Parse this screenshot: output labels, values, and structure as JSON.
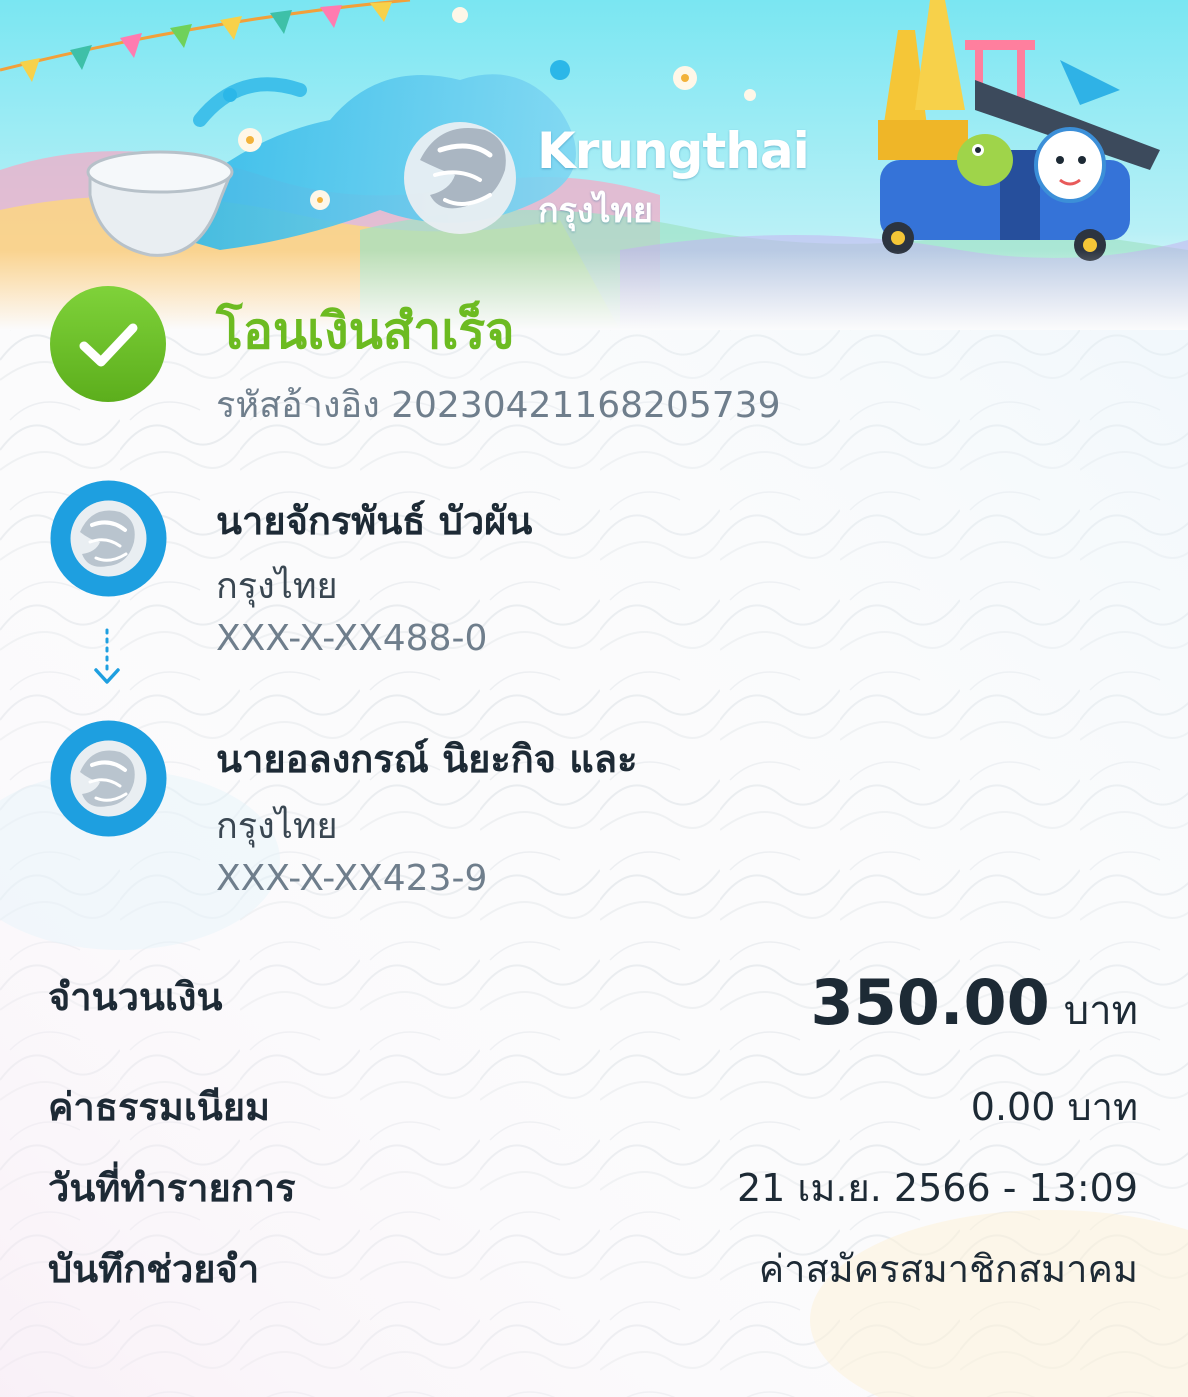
{
  "header": {
    "brand_name": "Krungthai",
    "brand_thai": "กรุงไทย"
  },
  "status": {
    "title": "โอนเงินสำเร็จ",
    "ref_label": "รหัสอ้างอิง",
    "ref_number": "20230421168205739"
  },
  "sender": {
    "name": "นายจักรพันธ์ บัวผัน",
    "bank": "กรุงไทย",
    "account": "XXX-X-XX488-0"
  },
  "receiver": {
    "name": "นายอลงกรณ์ นิยะกิจ และ",
    "bank": "กรุงไทย",
    "account": "XXX-X-XX423-9"
  },
  "details": {
    "amount_label": "จำนวนเงิน",
    "amount_value": "350.00",
    "amount_unit": "บาท",
    "fee_label": "ค่าธรรมเนียม",
    "fee_value": "0.00 บาท",
    "date_label": "วันที่ทำรายการ",
    "date_value": "21 เม.ย. 2566 - 13:09",
    "memo_label": "บันทึกช่วยจำ",
    "memo_value": "ค่าสมัครสมาชิกสมาคม"
  },
  "colors": {
    "success_green": "#6cbb21",
    "bank_blue": "#1e9fe0",
    "text_dark": "#1d2a35",
    "text_muted": "#6f7e8c"
  },
  "icons": {
    "status": "check-circle-icon",
    "bank": "krungthai-bird-logo",
    "connector": "dotted-down-arrow-icon"
  }
}
